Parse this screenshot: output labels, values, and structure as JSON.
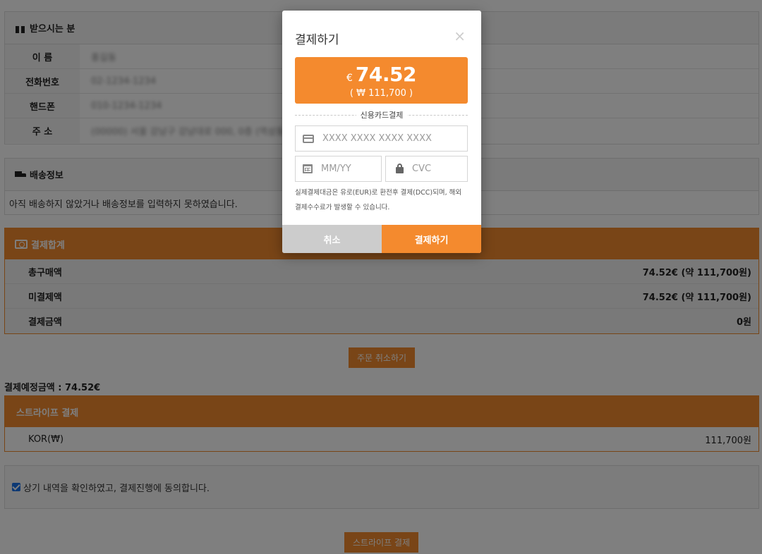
{
  "recipient": {
    "title": "받으시는 분",
    "rows": [
      {
        "label": "이 름",
        "value": "홍길동"
      },
      {
        "label": "전화번호",
        "value": "02-1234-1234"
      },
      {
        "label": "핸드폰",
        "value": "010-1234-1234"
      },
      {
        "label": "주 소",
        "value": "(00000) 서울 강남구 강남대로 000, 0층 (역삼동) 000"
      }
    ]
  },
  "shipping": {
    "title": "배송정보",
    "message": "아직 배송하지 않았거나 배송정보를 입력하지 못하였습니다."
  },
  "payment_total": {
    "title": "결제합계",
    "rows": [
      {
        "label": "총구매액",
        "value": "74.52€ (약 111,700원)"
      },
      {
        "label": "미결제액",
        "value": "74.52€ (약 111,700원)"
      },
      {
        "label": "결제금액",
        "value": "0원"
      }
    ]
  },
  "cancel_order_label": "주문 취소하기",
  "expected_amount": "결제예정금액 : 74.52€",
  "stripe": {
    "title": "스트라이프 결제",
    "row_label": "KOR(₩)",
    "row_value": "111,700원"
  },
  "agree_text": "상기 내역을 확인하였고, 결제진행에 동의합니다.",
  "stripe_pay_label": "스트라이프 결제",
  "modal": {
    "title": "결제하기",
    "close": "×",
    "currency_symbol": "€",
    "amount": "74.52",
    "amount_krw": "( ₩ 111,700 )",
    "section_label": "신용카드결제",
    "card_placeholder": "XXXX XXXX XXXX XXXX",
    "expiry_placeholder": "MM/YY",
    "cvc_placeholder": "CVC",
    "notice_line1": "실제결제대금은 유로(EUR)로 환전후 결제(DCC)되며, 해외",
    "notice_line2": "결제수수료가 발생할 수 있습니다.",
    "cancel_label": "취소",
    "pay_label": "결제하기"
  },
  "colors": {
    "accent": "#f28a2e",
    "cancel_gray": "#cccccc"
  }
}
